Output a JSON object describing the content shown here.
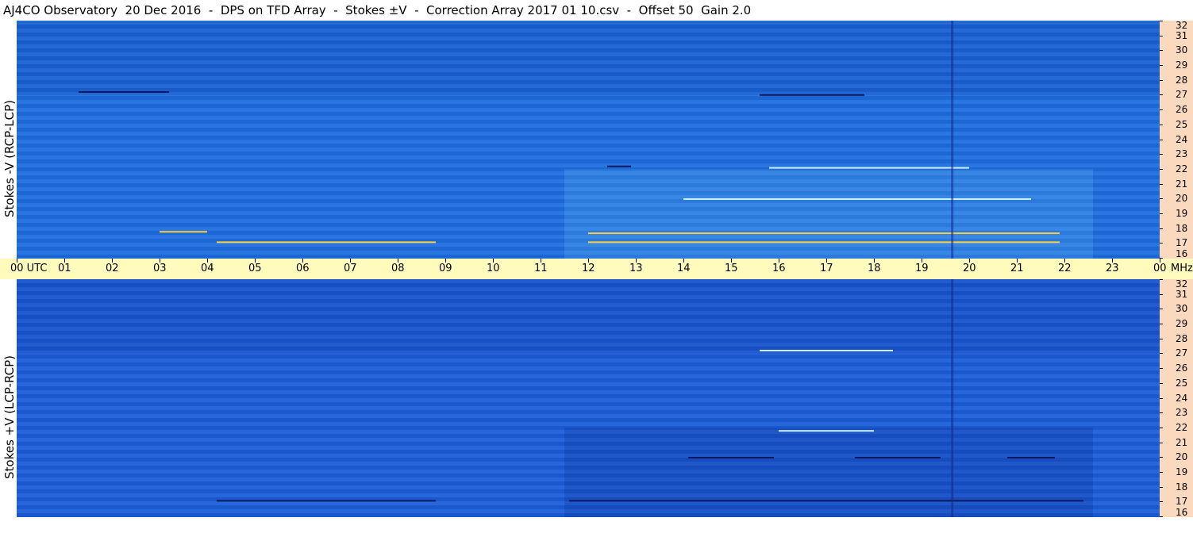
{
  "title": "AJ4CO Observatory  20 Dec 2016  -  DPS on TFD Array  -  Stokes ±V  -  Correction Array 2017 01 10.csv  -  Offset 50  Gain 2.0",
  "chart_data": [
    {
      "type": "heatmap",
      "ylabel": "Stokes -V (RCP-LCP)",
      "y_unit": "MHz",
      "ylim": [
        16,
        32
      ],
      "y_ticks": [
        "32",
        "31",
        "30",
        "29",
        "28",
        "27",
        "26",
        "25",
        "24",
        "23",
        "22",
        "21",
        "20",
        "19",
        "18",
        "17",
        "16"
      ],
      "xlim_utc_hours": [
        0,
        24
      ],
      "features": [
        {
          "utc_start": 3.0,
          "utc_end": 4.0,
          "freq_mhz": 17.8,
          "level": "warm"
        },
        {
          "utc_start": 4.2,
          "utc_end": 8.8,
          "freq_mhz": 17.1,
          "level": "warm"
        },
        {
          "utc_start": 12.0,
          "utc_end": 21.9,
          "freq_mhz": 17.7,
          "level": "warm"
        },
        {
          "utc_start": 12.0,
          "utc_end": 21.9,
          "freq_mhz": 17.1,
          "level": "warm"
        },
        {
          "utc_start": 14.0,
          "utc_end": 21.3,
          "freq_mhz": 20.0,
          "level": "bright"
        },
        {
          "utc_start": 15.8,
          "utc_end": 20.0,
          "freq_mhz": 22.1,
          "level": "bright"
        },
        {
          "utc_start": 15.6,
          "utc_end": 17.8,
          "freq_mhz": 27.0,
          "level": "dark"
        },
        {
          "utc_start": 1.3,
          "utc_end": 3.2,
          "freq_mhz": 27.2,
          "level": "dark"
        },
        {
          "utc_start": 12.4,
          "utc_end": 12.9,
          "freq_mhz": 22.2,
          "level": "dark"
        }
      ]
    },
    {
      "type": "heatmap",
      "ylabel": "Stokes +V (LCP-RCP)",
      "y_unit": "MHz",
      "ylim": [
        16,
        32
      ],
      "y_ticks": [
        "32",
        "31",
        "30",
        "29",
        "28",
        "27",
        "26",
        "25",
        "24",
        "23",
        "22",
        "21",
        "20",
        "19",
        "18",
        "17",
        "16"
      ],
      "xlim_utc_hours": [
        0,
        24
      ],
      "features": [
        {
          "utc_start": 4.2,
          "utc_end": 8.8,
          "freq_mhz": 17.1,
          "level": "dark"
        },
        {
          "utc_start": 11.6,
          "utc_end": 22.4,
          "freq_mhz": 17.1,
          "level": "dark"
        },
        {
          "utc_start": 14.1,
          "utc_end": 15.9,
          "freq_mhz": 20.0,
          "level": "dark"
        },
        {
          "utc_start": 17.6,
          "utc_end": 19.4,
          "freq_mhz": 20.0,
          "level": "dark"
        },
        {
          "utc_start": 20.8,
          "utc_end": 21.8,
          "freq_mhz": 20.0,
          "level": "dark"
        },
        {
          "utc_start": 15.6,
          "utc_end": 18.4,
          "freq_mhz": 27.2,
          "level": "bright"
        },
        {
          "utc_start": 16.0,
          "utc_end": 18.0,
          "freq_mhz": 21.8,
          "level": "bright"
        }
      ]
    }
  ],
  "time_axis": {
    "labels": [
      "00  UTC",
      "01",
      "02",
      "03",
      "04",
      "05",
      "06",
      "07",
      "08",
      "09",
      "10",
      "11",
      "12",
      "13",
      "14",
      "15",
      "16",
      "17",
      "18",
      "19",
      "20",
      "21",
      "22",
      "23",
      "00"
    ],
    "unit": "MHz"
  },
  "colors": {
    "panel_top_base": "#1f6fe0",
    "panel_bottom_base": "#1c5fda",
    "freq_axis_bg": "#fad9bf",
    "time_axis_bg": "#fffbbd",
    "warm": "#ffd040",
    "bright": "#c8f0ff",
    "dark": "#0a1860"
  }
}
